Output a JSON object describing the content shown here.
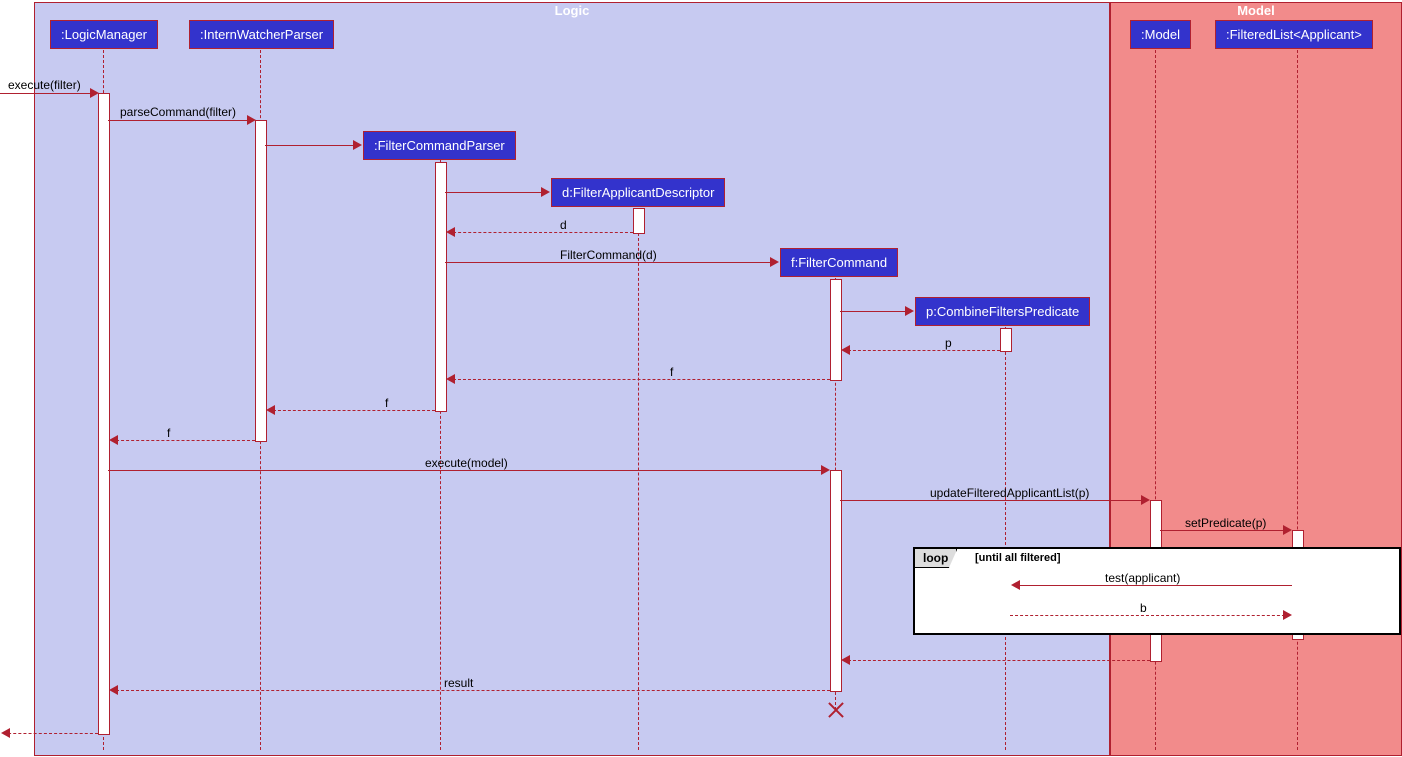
{
  "boxes": {
    "logic": "Logic",
    "model": "Model"
  },
  "participants": {
    "logicManager": ":LogicManager",
    "internWatcherParser": ":InternWatcherParser",
    "filterCommandParser": ":FilterCommandParser",
    "filterApplicantDescriptor": "d:FilterApplicantDescriptor",
    "filterCommand": "f:FilterCommand",
    "combineFiltersPredicate": "p:CombineFiltersPredicate",
    "model": ":Model",
    "filteredList": ":FilteredList<Applicant>"
  },
  "messages": {
    "executeFilter": "execute(filter)",
    "parseCommand": "parseCommand(filter)",
    "d": "d",
    "filterCommandD": "FilterCommand(d)",
    "p": "p",
    "f": "f",
    "executeModel": "execute(model)",
    "updateFiltered": "updateFilteredApplicantList(p)",
    "setPredicate": "setPredicate(p)",
    "testApplicant": "test(applicant)",
    "b": "b",
    "result": "result"
  },
  "loop": {
    "label": "loop",
    "condition": "[until all filtered]"
  },
  "chart_data": {
    "type": "sequence_diagram",
    "boxes": [
      {
        "name": "Logic",
        "participants": [
          "LogicManager",
          "InternWatcherParser",
          "FilterCommandParser",
          "d:FilterApplicantDescriptor",
          "f:FilterCommand",
          "p:CombineFiltersPredicate"
        ]
      },
      {
        "name": "Model",
        "participants": [
          "Model",
          "FilteredList<Applicant>"
        ]
      }
    ],
    "messages": [
      {
        "from": "external",
        "to": "LogicManager",
        "label": "execute(filter)",
        "type": "sync"
      },
      {
        "from": "LogicManager",
        "to": "InternWatcherParser",
        "label": "parseCommand(filter)",
        "type": "sync"
      },
      {
        "from": "InternWatcherParser",
        "to": "FilterCommandParser",
        "label": "",
        "type": "create"
      },
      {
        "from": "FilterCommandParser",
        "to": "d:FilterApplicantDescriptor",
        "label": "",
        "type": "create"
      },
      {
        "from": "d:FilterApplicantDescriptor",
        "to": "FilterCommandParser",
        "label": "d",
        "type": "return"
      },
      {
        "from": "FilterCommandParser",
        "to": "f:FilterCommand",
        "label": "FilterCommand(d)",
        "type": "create"
      },
      {
        "from": "f:FilterCommand",
        "to": "p:CombineFiltersPredicate",
        "label": "",
        "type": "create"
      },
      {
        "from": "p:CombineFiltersPredicate",
        "to": "f:FilterCommand",
        "label": "p",
        "type": "return"
      },
      {
        "from": "f:FilterCommand",
        "to": "FilterCommandParser",
        "label": "f",
        "type": "return"
      },
      {
        "from": "FilterCommandParser",
        "to": "InternWatcherParser",
        "label": "f",
        "type": "return"
      },
      {
        "from": "InternWatcherParser",
        "to": "LogicManager",
        "label": "f",
        "type": "return"
      },
      {
        "from": "LogicManager",
        "to": "f:FilterCommand",
        "label": "execute(model)",
        "type": "sync"
      },
      {
        "from": "f:FilterCommand",
        "to": "Model",
        "label": "updateFilteredApplicantList(p)",
        "type": "sync"
      },
      {
        "from": "Model",
        "to": "FilteredList<Applicant>",
        "label": "setPredicate(p)",
        "type": "sync"
      },
      {
        "loop": "until all filtered",
        "messages": [
          {
            "from": "FilteredList<Applicant>",
            "to": "p:CombineFiltersPredicate",
            "label": "test(applicant)",
            "type": "sync"
          },
          {
            "from": "p:CombineFiltersPredicate",
            "to": "FilteredList<Applicant>",
            "label": "b",
            "type": "return"
          }
        ]
      },
      {
        "from": "Model",
        "to": "f:FilterCommand",
        "label": "",
        "type": "return"
      },
      {
        "from": "f:FilterCommand",
        "to": "LogicManager",
        "label": "result",
        "type": "return"
      },
      {
        "from": "f:FilterCommand",
        "to": "f:FilterCommand",
        "label": "",
        "type": "destroy"
      },
      {
        "from": "LogicManager",
        "to": "external",
        "label": "",
        "type": "return"
      }
    ]
  }
}
